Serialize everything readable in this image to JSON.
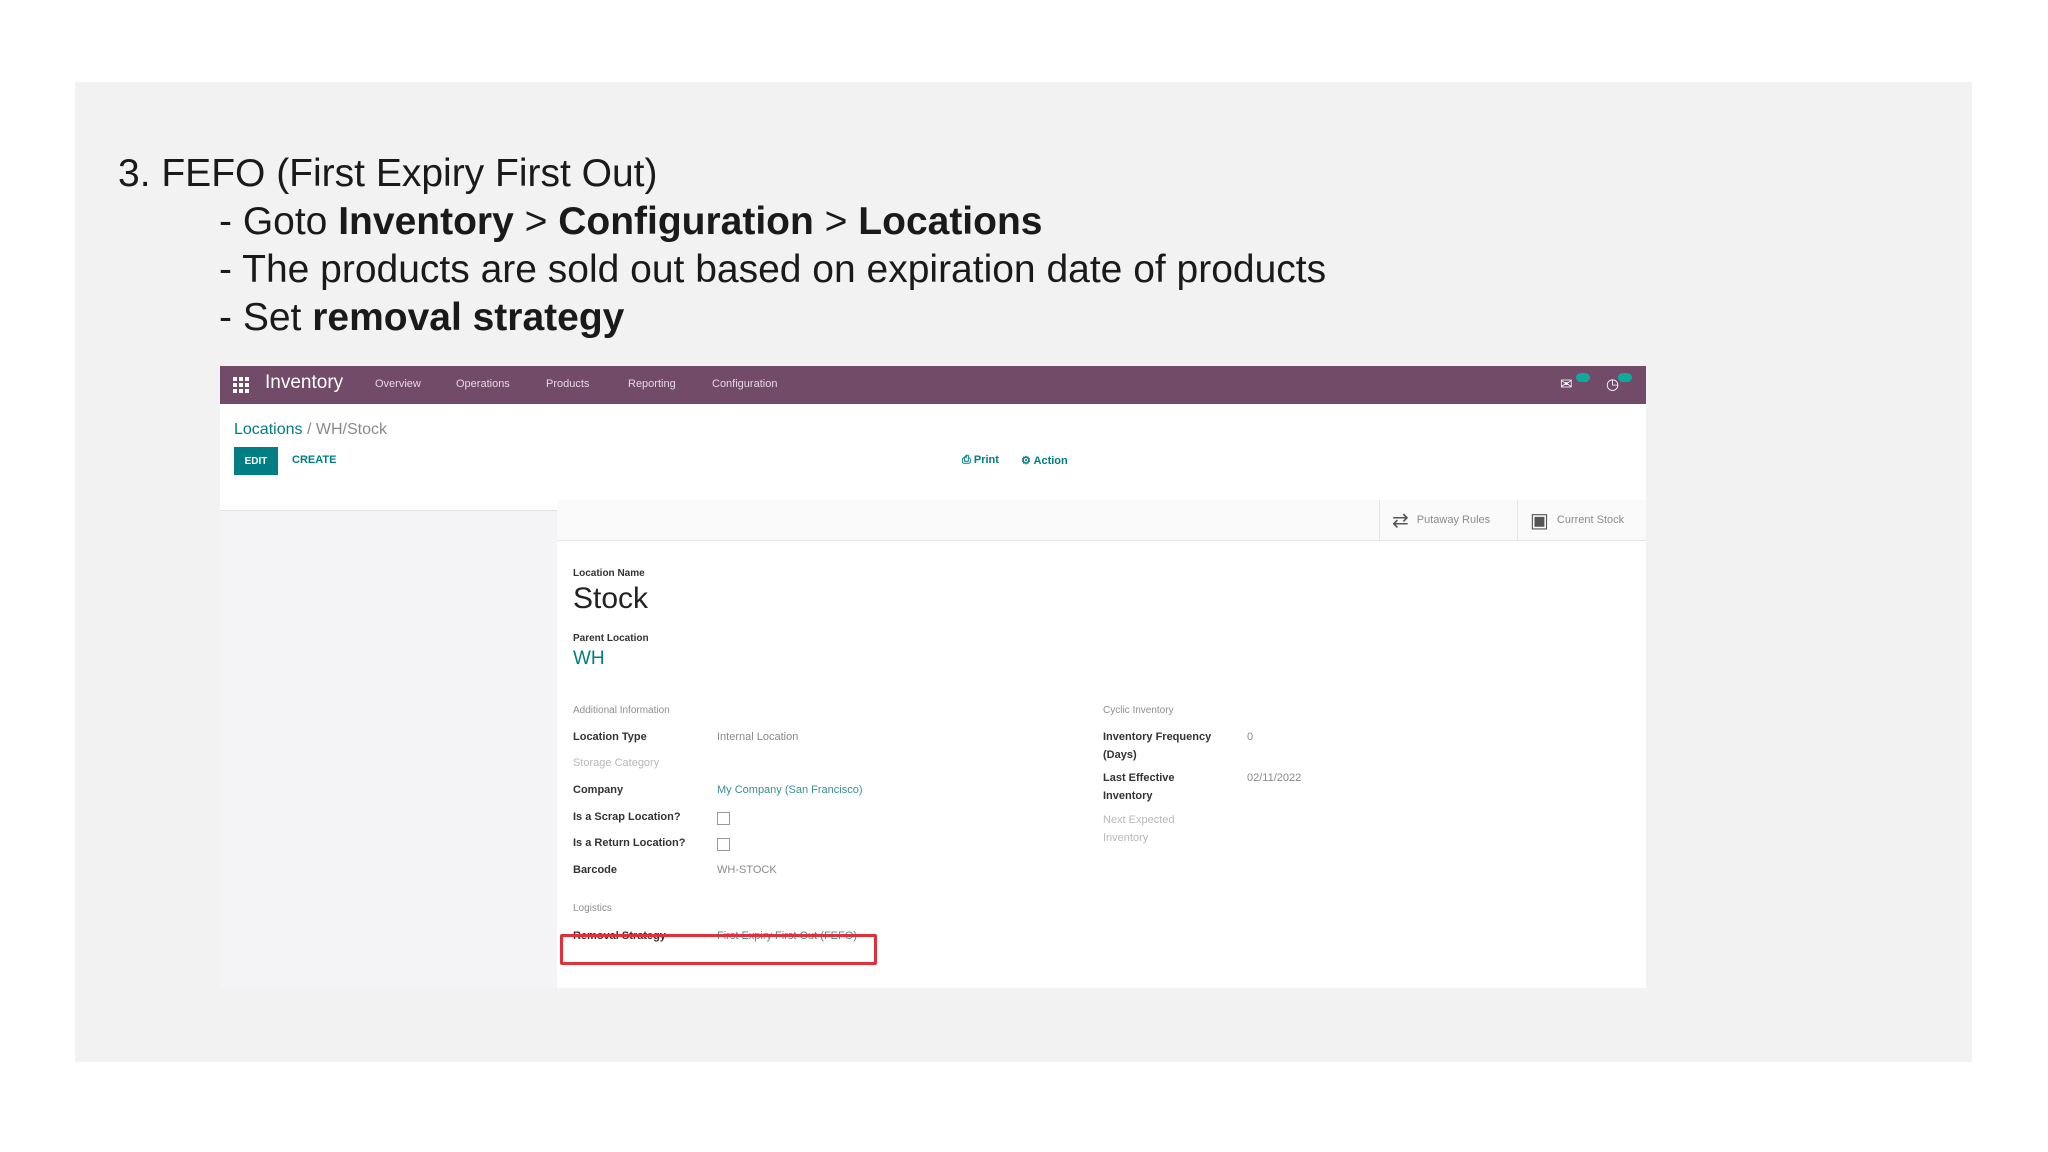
{
  "instructions": {
    "heading": "3. FEFO (First Expiry First Out)",
    "step1": {
      "prefix": "- Goto ",
      "part1": "Inventory",
      "sep1": " > ",
      "part2": "Configuration",
      "sep2": " > ",
      "part3": "Locations"
    },
    "step2": "- The products are sold out based on expiration date of products",
    "step3": {
      "prefix": "- Set ",
      "bold": "removal strategy"
    }
  },
  "navbar": {
    "app_name": "Inventory",
    "menu": [
      "Overview",
      "Operations",
      "Products",
      "Reporting",
      "Configuration"
    ],
    "color": "#714b67"
  },
  "breadcrumb": {
    "parent": "Locations",
    "separator": " / ",
    "current": "WH/Stock"
  },
  "buttons": {
    "edit": "EDIT",
    "create": "CREATE",
    "print": "⎙ Print",
    "action": "⚙ Action"
  },
  "smart_buttons": {
    "putaway": "Putaway Rules",
    "current_stock": "Current Stock"
  },
  "form": {
    "location_name_label": "Location Name",
    "location_name": "Stock",
    "parent_location_label": "Parent Location",
    "parent_location": "WH",
    "additional_info_heading": "Additional Information",
    "location_type_label": "Location Type",
    "location_type": "Internal Location",
    "storage_category_label": "Storage Category",
    "company_label": "Company",
    "company": "My Company (San Francisco)",
    "scrap_label": "Is a Scrap Location?",
    "return_label": "Is a Return Location?",
    "barcode_label": "Barcode",
    "barcode": "WH-STOCK",
    "logistics_heading": "Logistics",
    "removal_strategy_label": "Removal Strategy",
    "removal_strategy": "First Expiry First Out (FEFO)",
    "cyclic_heading": "Cyclic Inventory",
    "inv_freq_label_1": "Inventory Frequency",
    "inv_freq_label_2": "(Days)",
    "inv_freq": "0",
    "last_eff_label_1": "Last Effective",
    "last_eff_label_2": "Inventory",
    "last_eff": "02/11/2022",
    "next_expected_1": "Next Expected",
    "next_expected_2": "Inventory"
  },
  "colors": {
    "accent": "#017e84",
    "highlight": "#e0303a"
  }
}
